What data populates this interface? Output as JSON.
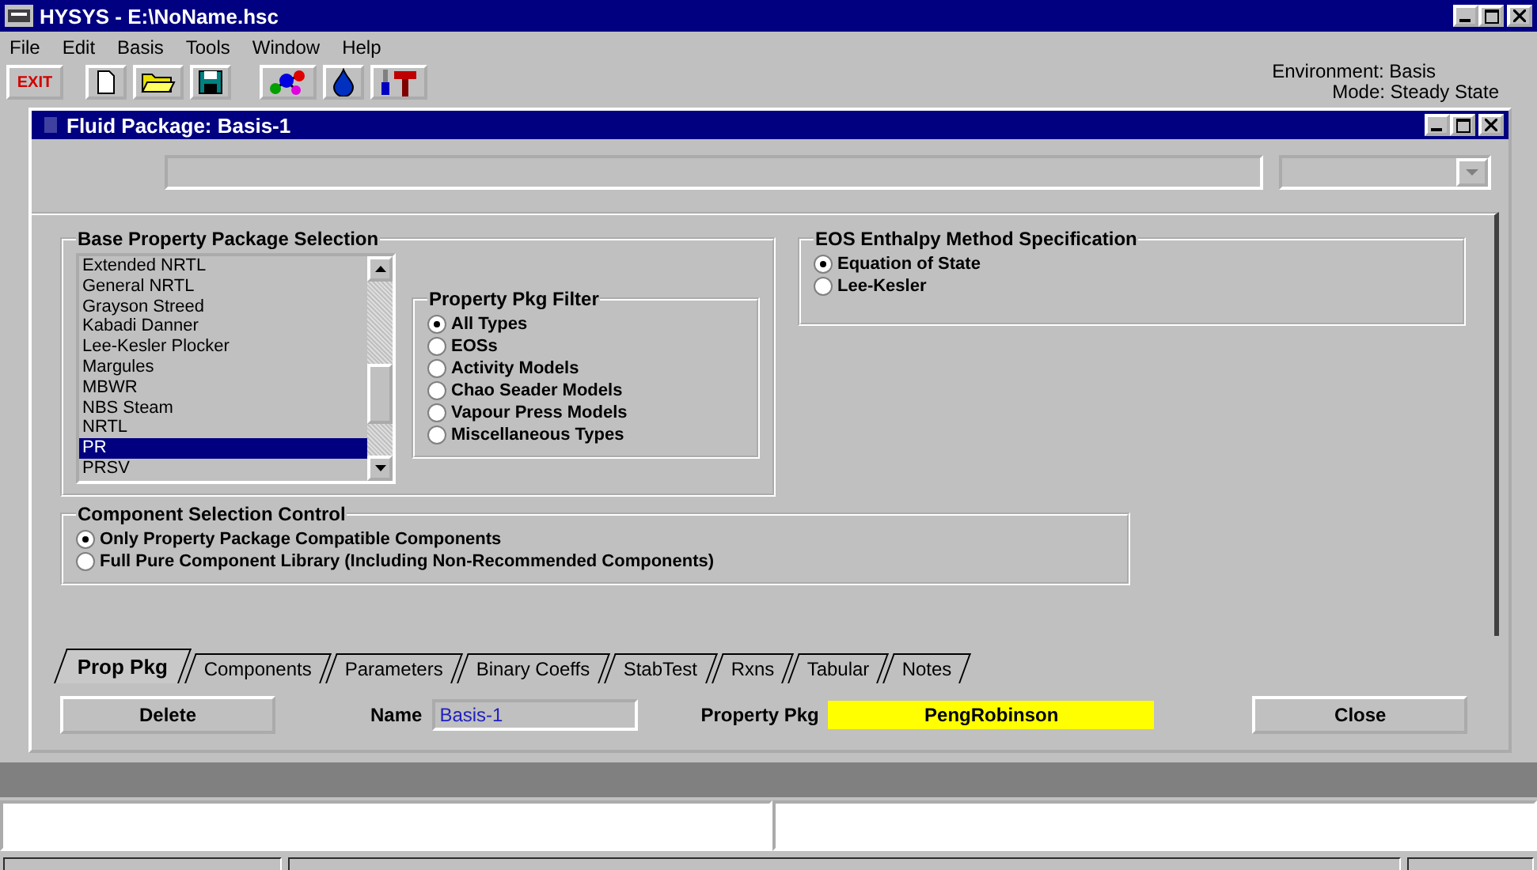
{
  "window": {
    "title": "HYSYS - E:\\NoName.hsc"
  },
  "menu": [
    {
      "label": "File"
    },
    {
      "label": "Edit"
    },
    {
      "label": "Basis"
    },
    {
      "label": "Tools"
    },
    {
      "label": "Window"
    },
    {
      "label": "Help"
    }
  ],
  "toolbar": {
    "exit_button": "EXIT",
    "environment": "Environment: Basis",
    "mode": "Mode: Steady State"
  },
  "fluid_package": {
    "title": "Fluid Package: Basis-1",
    "base_property_package": {
      "title": "Base Property Package Selection",
      "items": [
        {
          "label": "Extended NRTL",
          "selected": false
        },
        {
          "label": "General NRTL",
          "selected": false
        },
        {
          "label": "Grayson Streed",
          "selected": false
        },
        {
          "label": "Kabadi Danner",
          "selected": false
        },
        {
          "label": "Lee-Kesler Plocker",
          "selected": false
        },
        {
          "label": "Margules",
          "selected": false
        },
        {
          "label": "MBWR",
          "selected": false
        },
        {
          "label": "NBS Steam",
          "selected": false
        },
        {
          "label": "NRTL",
          "selected": false
        },
        {
          "label": "PR",
          "selected": true
        },
        {
          "label": "PRSV",
          "selected": false
        }
      ]
    },
    "filter": {
      "title": "Property Pkg Filter",
      "options": [
        {
          "label": "All Types",
          "selected": true
        },
        {
          "label": "EOSs",
          "selected": false
        },
        {
          "label": "Activity Models",
          "selected": false
        },
        {
          "label": "Chao Seader Models",
          "selected": false
        },
        {
          "label": "Vapour Press Models",
          "selected": false
        },
        {
          "label": "Miscellaneous Types",
          "selected": false
        }
      ]
    },
    "eos_enthalpy": {
      "title": "EOS Enthalpy Method Specification",
      "options": [
        {
          "label": "Equation of State",
          "selected": true
        },
        {
          "label": "Lee-Kesler",
          "selected": false
        }
      ]
    },
    "component_selection": {
      "title": "Component Selection Control",
      "options": [
        {
          "label": "Only Property Package Compatible Components",
          "selected": true
        },
        {
          "label": "Full Pure Component Library (Including Non-Recommended Components)",
          "selected": false
        }
      ]
    },
    "tabs": [
      {
        "label": "Prop Pkg",
        "selected": true
      },
      {
        "label": "Components",
        "selected": false
      },
      {
        "label": "Parameters",
        "selected": false
      },
      {
        "label": "Binary Coeffs",
        "selected": false
      },
      {
        "label": "StabTest",
        "selected": false
      },
      {
        "label": "Rxns",
        "selected": false
      },
      {
        "label": "Tabular",
        "selected": false
      },
      {
        "label": "Notes",
        "selected": false
      }
    ],
    "delete_button": "Delete",
    "name_label": "Name",
    "name_value": "Basis-1",
    "property_pkg_label": "Property Pkg",
    "property_pkg_value": "PengRobinson",
    "close_button": "Close"
  }
}
